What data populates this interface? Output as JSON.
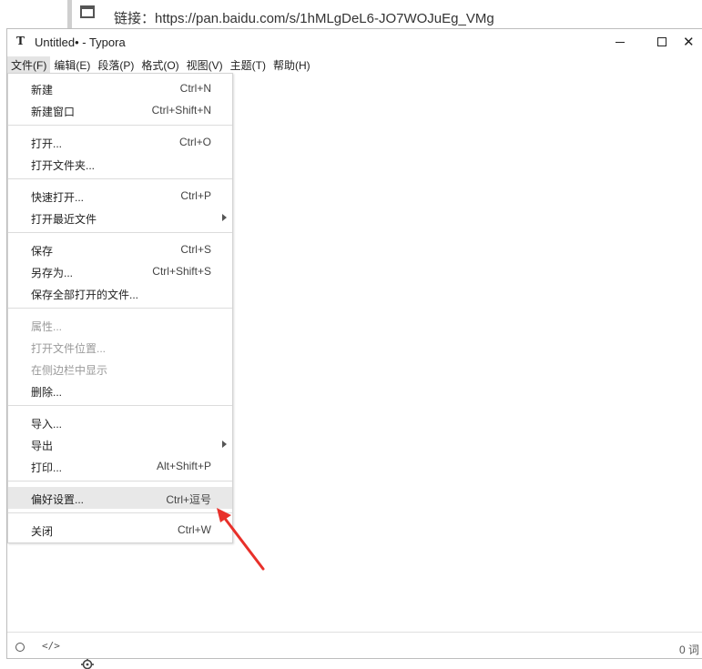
{
  "background": {
    "link_text": "链接：https://pan.baidu.com/s/1hMLgDeL6-JO7WOJuEg_VMg"
  },
  "window": {
    "icon_letter": "T",
    "title": "Untitled• - Typora",
    "close_glyph": "✕"
  },
  "menubar": {
    "items": [
      {
        "label": "文件(F)"
      },
      {
        "label": "编辑(E)"
      },
      {
        "label": "段落(P)"
      },
      {
        "label": "格式(O)"
      },
      {
        "label": "视图(V)"
      },
      {
        "label": "主题(T)"
      },
      {
        "label": "帮助(H)"
      }
    ]
  },
  "file_menu": {
    "new": {
      "label": "新建",
      "shortcut": "Ctrl+N"
    },
    "new_window": {
      "label": "新建窗口",
      "shortcut": "Ctrl+Shift+N"
    },
    "open": {
      "label": "打开...",
      "shortcut": "Ctrl+O"
    },
    "open_folder": {
      "label": "打开文件夹..."
    },
    "quick_open": {
      "label": "快速打开...",
      "shortcut": "Ctrl+P"
    },
    "open_recent": {
      "label": "打开最近文件"
    },
    "save": {
      "label": "保存",
      "shortcut": "Ctrl+S"
    },
    "save_as": {
      "label": "另存为...",
      "shortcut": "Ctrl+Shift+S"
    },
    "save_all": {
      "label": "保存全部打开的文件..."
    },
    "properties": {
      "label": "属性..."
    },
    "open_location": {
      "label": "打开文件位置..."
    },
    "reveal_sidebar": {
      "label": "在侧边栏中显示"
    },
    "delete": {
      "label": "删除..."
    },
    "import": {
      "label": "导入..."
    },
    "export": {
      "label": "导出"
    },
    "print": {
      "label": "打印...",
      "shortcut": "Alt+Shift+P"
    },
    "preferences": {
      "label": "偏好设置...",
      "shortcut": "Ctrl+逗号"
    },
    "close": {
      "label": "关闭",
      "shortcut": "Ctrl+W"
    }
  },
  "statusbar": {
    "code_glyph": "</>",
    "word_count": "0 词"
  },
  "colors": {
    "annotation_arrow": "#e8302a",
    "menu_highlight": "#e8e8e8"
  }
}
